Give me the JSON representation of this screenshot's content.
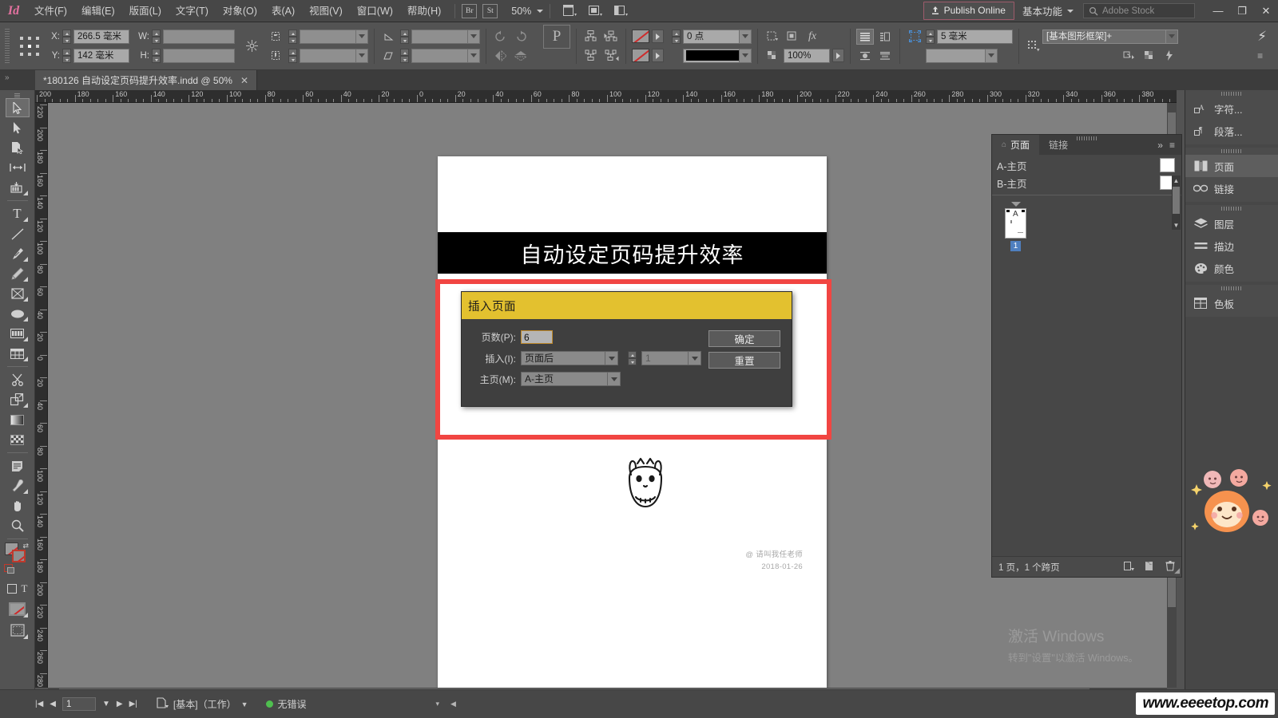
{
  "app": {
    "logo": "Id"
  },
  "menubar": {
    "items": [
      {
        "label": "文件(F)",
        "name": "menu-file"
      },
      {
        "label": "编辑(E)",
        "name": "menu-edit"
      },
      {
        "label": "版面(L)",
        "name": "menu-layout"
      },
      {
        "label": "文字(T)",
        "name": "menu-type"
      },
      {
        "label": "对象(O)",
        "name": "menu-object"
      },
      {
        "label": "表(A)",
        "name": "menu-table"
      },
      {
        "label": "视图(V)",
        "name": "menu-view"
      },
      {
        "label": "窗口(W)",
        "name": "menu-window"
      },
      {
        "label": "帮助(H)",
        "name": "menu-help"
      }
    ],
    "bridge_label": "Br",
    "stock_label": "St",
    "zoom_level": "50%",
    "publish_label": "Publish Online",
    "workspace": "基本功能",
    "stock_placeholder": "Adobe Stock",
    "min_label": "—",
    "restore_label": "❐",
    "close_label": "✕"
  },
  "control_bar": {
    "x_label": "X:",
    "x_value": "266.5 毫米",
    "y_label": "Y:",
    "y_value": "142 毫米",
    "w_label": "W:",
    "w_value": "",
    "h_label": "H:",
    "h_value": "",
    "stroke_weight": "0 点",
    "opacity": "100%",
    "corner_radius": "5 毫米",
    "object_style": "[基本图形框架]+"
  },
  "document_tab": {
    "title": "*180126 自动设定页码提升效率.indd @ 50%",
    "close": "✕"
  },
  "rulers": {
    "h_ticks": [
      "200",
      "180",
      "160",
      "140",
      "120",
      "100",
      "80",
      "60",
      "40",
      "20",
      "0",
      "20",
      "40",
      "60",
      "80",
      "100",
      "120",
      "140",
      "160",
      "180",
      "200",
      "220",
      "240",
      "260",
      "280",
      "300",
      "320",
      "340",
      "360",
      "380"
    ],
    "v_ticks": [
      "2 2 0",
      "2 0 0",
      "1 8 0",
      "1 6 0",
      "1 4 0",
      "1 2 0",
      "1 0 0",
      "8 0",
      "6 0",
      "4 0",
      "2 0",
      "0",
      "2 0",
      "4 0",
      "6 0",
      "8 0",
      "1 0 0",
      "1 2 0",
      "1 4 0",
      "1 6 0",
      "1 8 0",
      "2 0 0",
      "2 2 0",
      "2 4 0",
      "2 6 0",
      "2 8 0"
    ]
  },
  "toolbar": {
    "tools": [
      {
        "name": "selection-tool",
        "glyph": "selection",
        "selected": true
      },
      {
        "name": "direct-selection-tool",
        "glyph": "direct",
        "selected": false
      },
      {
        "name": "page-tool",
        "glyph": "page",
        "selected": false
      },
      {
        "name": "gap-tool",
        "glyph": "gap",
        "selected": false
      },
      {
        "name": "content-collector-tool",
        "glyph": "collector",
        "selected": false
      },
      {
        "name": "type-tool",
        "glyph": "type",
        "selected": false
      },
      {
        "name": "line-tool",
        "glyph": "line",
        "selected": false
      },
      {
        "name": "pen-tool",
        "glyph": "pen",
        "selected": false
      },
      {
        "name": "pencil-tool",
        "glyph": "pencil",
        "selected": false
      },
      {
        "name": "rectangle-frame-tool",
        "glyph": "frame",
        "selected": false
      },
      {
        "name": "ellipse-tool",
        "glyph": "ellipse",
        "selected": false
      },
      {
        "name": "grid-frame-tool",
        "glyph": "grid",
        "selected": false
      },
      {
        "name": "table-tool",
        "glyph": "table",
        "selected": false
      },
      {
        "name": "scissors-tool",
        "glyph": "scissors",
        "selected": false
      },
      {
        "name": "free-transform-tool",
        "glyph": "transform",
        "selected": false
      },
      {
        "name": "gradient-swatch-tool",
        "glyph": "gradient",
        "selected": false
      },
      {
        "name": "gradient-feather-tool",
        "glyph": "feather",
        "selected": false
      },
      {
        "name": "note-tool",
        "glyph": "note",
        "selected": false
      },
      {
        "name": "eyedropper-tool",
        "glyph": "eyedropper",
        "selected": false
      },
      {
        "name": "hand-tool",
        "glyph": "hand",
        "selected": false
      },
      {
        "name": "zoom-tool",
        "glyph": "zoom",
        "selected": false
      }
    ]
  },
  "document": {
    "banner_title": "自动设定页码提升效率",
    "signature_author": "@ 请叫我任老师",
    "signature_date": "2018-01-26"
  },
  "dialog": {
    "title": "插入页面",
    "pages_label": "页数(P):",
    "pages_value": "6",
    "insert_label": "插入(I):",
    "insert_value": "页面后",
    "insert_page_number": "1",
    "master_label": "主页(M):",
    "master_value": "A-主页",
    "ok_label": "确定",
    "reset_label": "重置"
  },
  "pages_panel": {
    "tabs": [
      {
        "label": "页面",
        "name": "panel-tab-pages",
        "active": true
      },
      {
        "label": "链接",
        "name": "panel-tab-links",
        "active": false
      }
    ],
    "collapse_label": "»",
    "menu_label": "≡",
    "masters": [
      {
        "label": "A-主页"
      },
      {
        "label": "B-主页"
      }
    ],
    "page_thumb_label": "A",
    "page_number": "1",
    "footer_text": "1 页，1 个跨页"
  },
  "dock": {
    "groups": [
      {
        "items": [
          {
            "label": "字符...",
            "icon": "character-icon",
            "active": false
          },
          {
            "label": "段落...",
            "icon": "paragraph-icon",
            "active": false
          }
        ]
      },
      {
        "items": [
          {
            "label": "页面",
            "icon": "pages-icon",
            "active": true
          },
          {
            "label": "链接",
            "icon": "links-icon",
            "active": false
          }
        ]
      },
      {
        "items": [
          {
            "label": "图层",
            "icon": "layers-icon",
            "active": false
          },
          {
            "label": "描边",
            "icon": "stroke-icon",
            "active": false
          },
          {
            "label": "颜色",
            "icon": "color-icon",
            "active": false
          }
        ]
      },
      {
        "items": [
          {
            "label": "色板",
            "icon": "swatches-icon",
            "active": false
          }
        ]
      }
    ]
  },
  "statusbar": {
    "page_number": "1",
    "preflight_profile": "[基本]（工作）",
    "error_status": "无错误"
  },
  "watermarks": {
    "windows_activate_title": "激活 Windows",
    "windows_activate_sub": "转到\"设置\"以激活 Windows。",
    "site": "www.eeeetop.com"
  },
  "colors": {
    "accent_yellow": "#e3c12f",
    "highlight_red": "#f14542",
    "publish_border": "#9d5b6b",
    "page_num_blue": "#4f7fbf",
    "status_green": "#4fbf4f"
  }
}
